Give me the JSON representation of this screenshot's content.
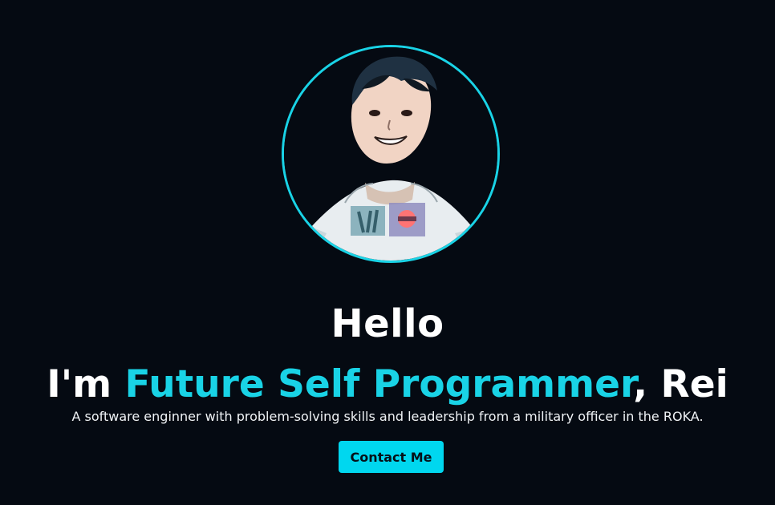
{
  "hero": {
    "greeting": "Hello",
    "intro_prefix": "I'm ",
    "highlight": "Future Self Programmer",
    "intro_suffix": ", Rei",
    "tagline": "A software enginner with problem-solving skills and leadership from a military officer in the ROKA.",
    "contact_label": "Contact Me"
  },
  "colors": {
    "background": "#050a12",
    "accent": "#19d3e6",
    "button": "#00d7ef",
    "text": "#ffffff"
  },
  "icons": {
    "avatar": "profile-illustration"
  }
}
